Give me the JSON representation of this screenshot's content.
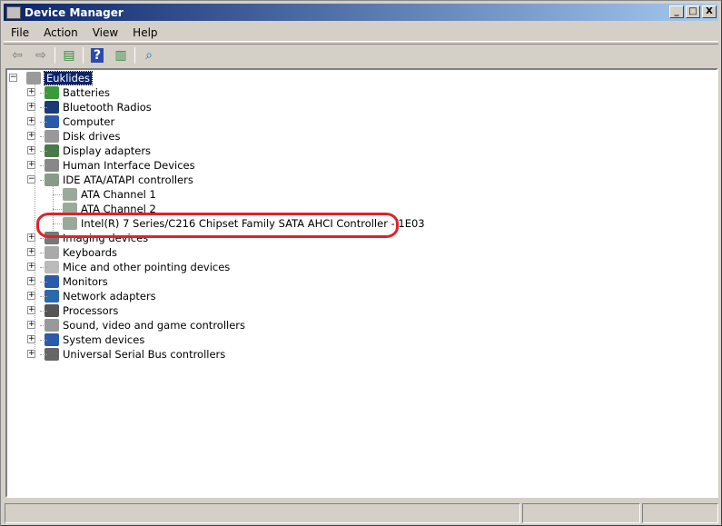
{
  "window": {
    "title": "Device Manager",
    "minimize": "_",
    "maximize": "□",
    "close": "X"
  },
  "menu": [
    "File",
    "Action",
    "View",
    "Help"
  ],
  "toolbar": [
    "back-icon",
    "forward-icon",
    "show-hide-console-tree-icon",
    "help-icon",
    "show-action-pane-icon",
    "scan-hardware-icon"
  ],
  "tree": {
    "root": "Euklides",
    "items": [
      {
        "label": "Batteries",
        "color": "#3a9a3a"
      },
      {
        "label": "Bluetooth Radios",
        "color": "#1a3a7a"
      },
      {
        "label": "Computer",
        "color": "#2a5aaa"
      },
      {
        "label": "Disk drives",
        "color": "#999999"
      },
      {
        "label": "Display adapters",
        "color": "#4a7a4a"
      },
      {
        "label": "Human Interface Devices",
        "color": "#888888"
      },
      {
        "label": "IDE ATA/ATAPI controllers",
        "color": "#8a9a8a",
        "expanded": true,
        "children": [
          "ATA Channel 1",
          "ATA Channel 2",
          "Intel(R) 7 Series/C216 Chipset Family SATA AHCI Controller - 1E03"
        ]
      },
      {
        "label": "Imaging devices",
        "color": "#777777"
      },
      {
        "label": "Keyboards",
        "color": "#aaaaaa"
      },
      {
        "label": "Mice and other pointing devices",
        "color": "#bbbbbb"
      },
      {
        "label": "Monitors",
        "color": "#2a5aaa"
      },
      {
        "label": "Network adapters",
        "color": "#2a6aaa"
      },
      {
        "label": "Processors",
        "color": "#555555"
      },
      {
        "label": "Sound, video and game controllers",
        "color": "#999999"
      },
      {
        "label": "System devices",
        "color": "#2a5aaa"
      },
      {
        "label": "Universal Serial Bus controllers",
        "color": "#666666"
      }
    ]
  },
  "highlight_color": "#e0222a"
}
